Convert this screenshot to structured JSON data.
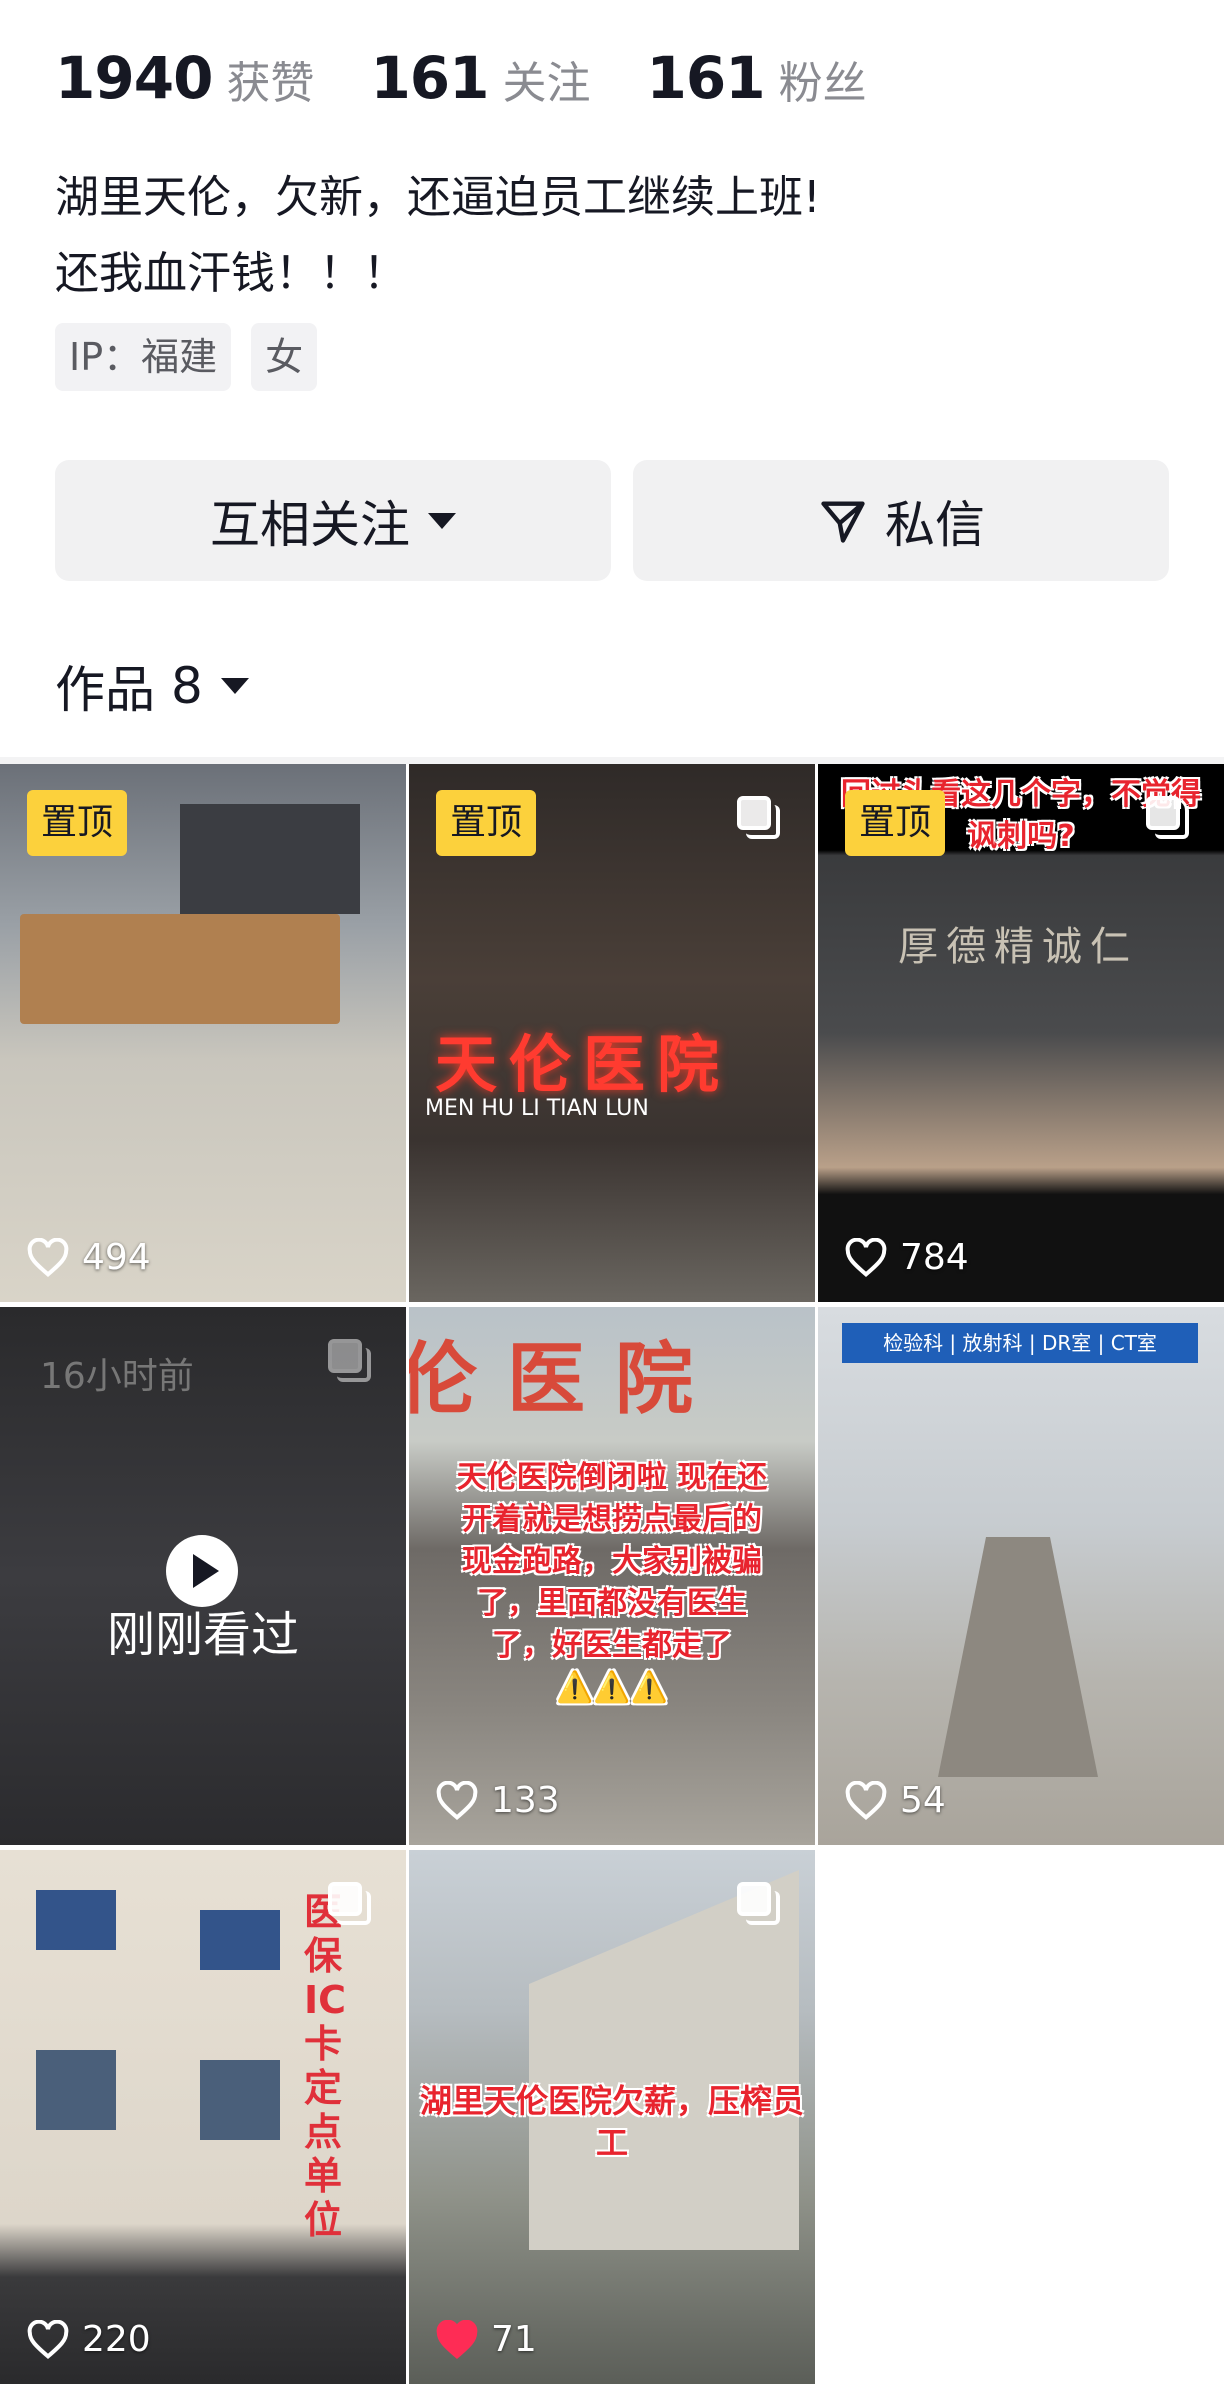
{
  "stats": [
    {
      "value": "1940",
      "label": "获赞"
    },
    {
      "value": "161",
      "label": "关注"
    },
    {
      "value": "161",
      "label": "粉丝"
    }
  ],
  "bio": {
    "line1": "湖里天伦，欠新，还逼迫员工继续上班!",
    "line2": "还我血汗钱！！！"
  },
  "tags": [
    "IP：福建",
    "女"
  ],
  "buttons": {
    "follow": "互相关注",
    "message": "私信"
  },
  "works": {
    "label": "作品",
    "count": "8"
  },
  "videos": [
    {
      "pinned": "置顶",
      "likes": "494",
      "multi": false
    },
    {
      "pinned": "置顶",
      "likes": "",
      "multi": true,
      "sign": "天伦医院",
      "sub": "MEN  HU  LI  TIAN  LUN"
    },
    {
      "pinned": "置顶",
      "likes": "784",
      "multi": true,
      "caption": "回过头看这几个字，不觉得讽刺吗?",
      "plaque": "厚德精诚仁"
    },
    {
      "watched": "刚刚看过",
      "time": "16小时前",
      "likes": "",
      "multi": true
    },
    {
      "likes": "133",
      "caption": "天伦医院倒闭啦 现在还开着就是想捞点最后的现金跑路，大家别被骗了，里面都没有医生了，好医生都走了⚠️⚠️⚠️",
      "sign": "伦医院"
    },
    {
      "likes": "54",
      "signboard": "检验科 | 放射科 | DR室 | CT室"
    },
    {
      "likes": "220",
      "multi": true,
      "vertical": "医保IC卡定点单位"
    },
    {
      "likes": "71",
      "liked": true,
      "multi": true,
      "caption": "湖里天伦医院欠薪，压榨员工"
    }
  ],
  "colors": {
    "pin": "#fcd13c",
    "liked": "#fe2c55",
    "accent": "#e8242e"
  }
}
